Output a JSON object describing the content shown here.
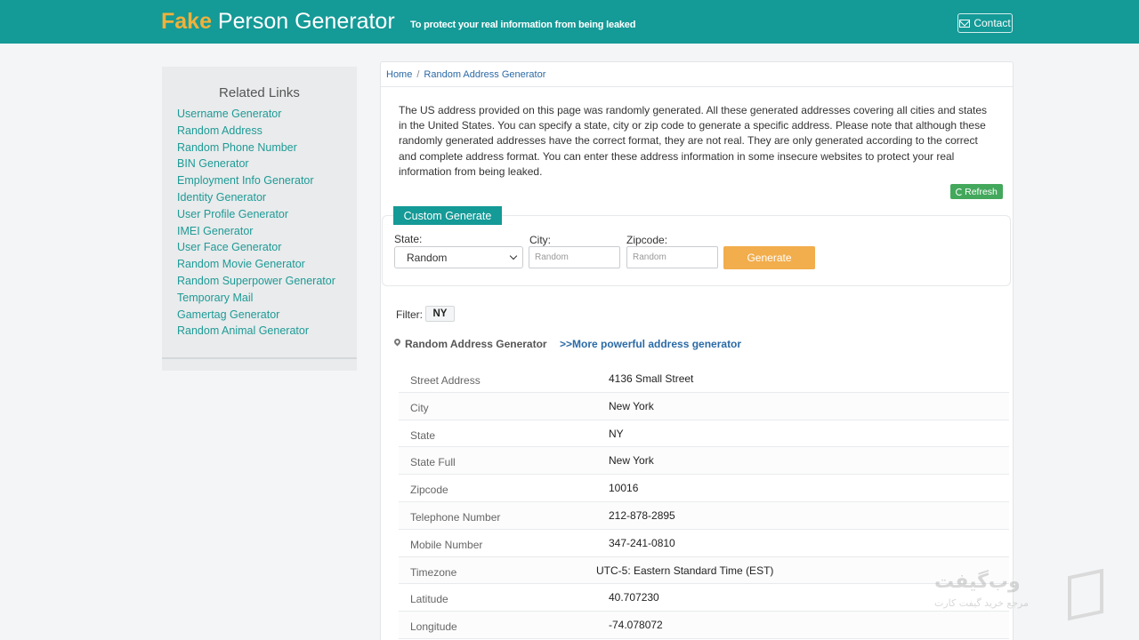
{
  "header": {
    "logo_fake": "Fake",
    "logo_rest": " Person Generator",
    "tagline": "To protect your real information from being leaked",
    "contact_label": "Contact"
  },
  "sidebar": {
    "title": "Related Links",
    "items": [
      "Username Generator",
      "Random Address",
      "Random Phone Number",
      "BIN Generator",
      "Employment Info Generator",
      "Identity Generator",
      "User Profile Generator",
      "IMEI Generator",
      "User Face Generator",
      "Random Movie Generator",
      "Random Superpower Generator",
      "Temporary Mail",
      "Gamertag Generator",
      "Random Animal Generator"
    ]
  },
  "breadcrumb": {
    "home": "Home",
    "separator": "/",
    "current": "Random Address Generator"
  },
  "intro": "The US address provided on this page was randomly generated. All these generated addresses covering all cities and states in the United States. You can specify a state, city or zip code to generate a specific address. Please note that although these randomly generated addresses have the correct format, they are not real. They are only generated according to the correct and complete address format. You can enter these address information in some insecure websites to protect your real information from being leaked.",
  "refresh_label": "Refresh",
  "custom": {
    "tab_label": "Custom Generate",
    "state_label": "State:",
    "state_value": "Random",
    "city_label": "City:",
    "city_placeholder": "Random",
    "zip_label": "Zipcode:",
    "zip_placeholder": "Random",
    "generate_label": "Generate"
  },
  "filter": {
    "label": "Filter:",
    "value": "NY"
  },
  "section": {
    "title": "Random Address Generator",
    "more_link": ">>More powerful address generator"
  },
  "address": [
    {
      "key": "Street Address",
      "value": "4136 Small Street"
    },
    {
      "key": "City",
      "value": "New York"
    },
    {
      "key": "State",
      "value": "NY"
    },
    {
      "key": "State Full",
      "value": "New York"
    },
    {
      "key": "Zipcode",
      "value": "10016"
    },
    {
      "key": "Telephone Number",
      "value": "212-878-2895"
    },
    {
      "key": "Mobile Number",
      "value": "347-241-0810"
    },
    {
      "key": "Timezone",
      "value": "UTC-5: Eastern Standard Time (EST)"
    },
    {
      "key": "Latitude",
      "value": "40.707230"
    },
    {
      "key": "Longitude",
      "value": "-74.078072"
    }
  ],
  "watermark": {
    "brand": "وب‌گیفت",
    "subtitle": "مرجع خرید گیفت کارت"
  }
}
